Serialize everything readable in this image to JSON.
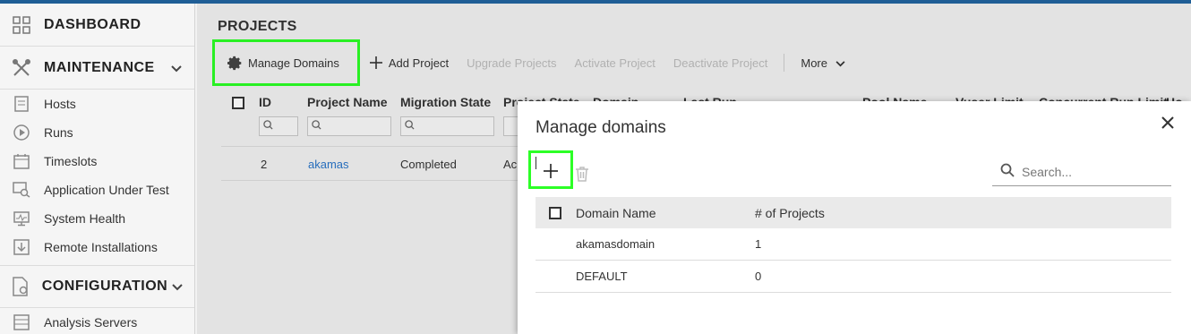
{
  "sidebar": {
    "dashboard": {
      "label": "DASHBOARD",
      "icon": "grid-icon"
    },
    "maintenance": {
      "label": "MAINTENANCE",
      "icon": "tools-icon",
      "items": [
        {
          "label": "Hosts",
          "icon": "server-icon"
        },
        {
          "label": "Runs",
          "icon": "play-icon"
        },
        {
          "label": "Timeslots",
          "icon": "calendar-icon"
        },
        {
          "label": "Application Under Test",
          "icon": "app-search-icon"
        },
        {
          "label": "System Health",
          "icon": "monitor-icon"
        },
        {
          "label": "Remote Installations",
          "icon": "download-icon"
        }
      ]
    },
    "configuration": {
      "label": "CONFIGURATION",
      "icon": "config-icon",
      "items": [
        {
          "label": "Analysis Servers",
          "icon": "servers-icon"
        }
      ]
    }
  },
  "main": {
    "title": "PROJECTS",
    "toolbar": {
      "manage_domains": "Manage Domains",
      "add_project": "Add Project",
      "upgrade_projects": "Upgrade Projects",
      "activate_project": "Activate Project",
      "deactivate_project": "Deactivate Project",
      "more": "More"
    },
    "grid": {
      "columns": [
        "ID",
        "Project Name",
        "Migration State",
        "Project State",
        "Domain",
        "Last Run",
        "Pool Name",
        "Vuser Limit",
        "Concurrent Run Limit",
        "Ho"
      ],
      "rows": [
        {
          "id": "2",
          "project_name": "akamas",
          "migration_state": "Completed",
          "project_state": "Ac"
        }
      ]
    }
  },
  "dialog": {
    "title": "Manage domains",
    "search_placeholder": "Search...",
    "columns": [
      "Domain Name",
      "# of Projects"
    ],
    "rows": [
      {
        "domain": "akamasdomain",
        "projects": "1"
      },
      {
        "domain": "DEFAULT",
        "projects": "0"
      }
    ]
  },
  "colors": {
    "highlight": "#2cff26",
    "link": "#2a75c8",
    "topbar": "#1f5e96"
  }
}
